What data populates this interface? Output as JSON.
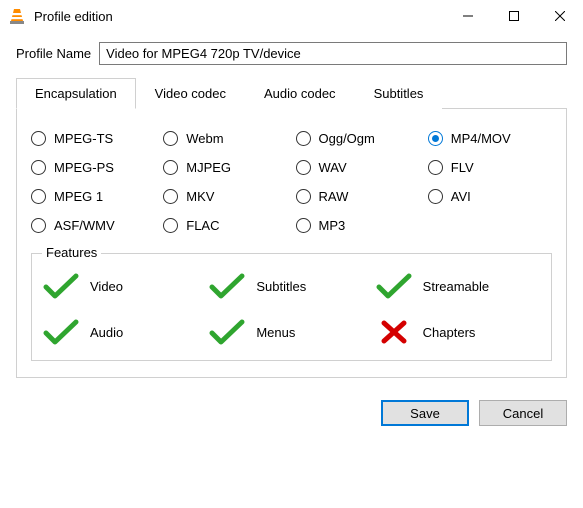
{
  "window": {
    "title": "Profile edition"
  },
  "profile": {
    "label": "Profile Name",
    "value": "Video for MPEG4 720p TV/device"
  },
  "tabs": {
    "active": 0,
    "items": [
      {
        "label": "Encapsulation"
      },
      {
        "label": "Video codec"
      },
      {
        "label": "Audio codec"
      },
      {
        "label": "Subtitles"
      }
    ]
  },
  "encapsulation": {
    "selected": "MP4/MOV",
    "options": [
      "MPEG-TS",
      "Webm",
      "Ogg/Ogm",
      "MP4/MOV",
      "MPEG-PS",
      "MJPEG",
      "WAV",
      "FLV",
      "MPEG 1",
      "MKV",
      "RAW",
      "AVI",
      "ASF/WMV",
      "FLAC",
      "MP3"
    ]
  },
  "features": {
    "legend": "Features",
    "items": [
      {
        "label": "Video",
        "supported": true
      },
      {
        "label": "Subtitles",
        "supported": true
      },
      {
        "label": "Streamable",
        "supported": true
      },
      {
        "label": "Audio",
        "supported": true
      },
      {
        "label": "Menus",
        "supported": true
      },
      {
        "label": "Chapters",
        "supported": false
      }
    ]
  },
  "buttons": {
    "save": "Save",
    "cancel": "Cancel"
  }
}
